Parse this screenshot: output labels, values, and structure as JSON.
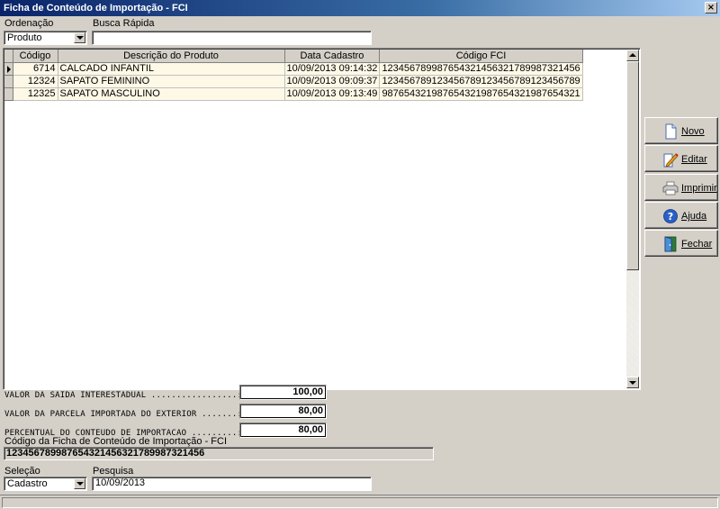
{
  "window": {
    "title": "Ficha de Conteúdo de Importação - FCI",
    "close_glyph": "×"
  },
  "filters": {
    "ordenacao_label": "Ordenação",
    "ordenacao_value": "Produto",
    "busca_label": "Busca Rápida",
    "busca_value": ""
  },
  "grid": {
    "columns": [
      "Código",
      "Descrição do Produto",
      "Data Cadastro",
      "Código FCI"
    ],
    "rows": [
      {
        "codigo": "6714",
        "descricao": "CALCADO INFANTIL",
        "data": "10/09/2013 09:14:32",
        "fci": "12345678998765432145632178998732145​6",
        "selected": true
      },
      {
        "codigo": "12324",
        "descricao": "SAPATO FEMININO",
        "data": "10/09/2013 09:09:37",
        "fci": "123456789123456789123456789123456789",
        "selected": false
      },
      {
        "codigo": "12325",
        "descricao": "SAPATO MASCULINO",
        "data": "10/09/2013 09:13:49",
        "fci": "987654321987654321987654321987654321",
        "selected": false
      }
    ]
  },
  "actions": {
    "novo": "Novo",
    "editar": "Editar",
    "imprimir": "Imprimir",
    "ajuda": "Ajuda",
    "fechar": "Fechar"
  },
  "details": {
    "saida_label": "VALOR DA SAIDA INTERESTADUAL .................:",
    "saida_value": "100,00",
    "parcela_label": "VALOR DA PARCELA IMPORTADA DO EXTERIOR .......:",
    "parcela_value": "80,00",
    "percentual_label": "PERCENTUAL DO CONTEUDO DE IMPORTACAO .........:",
    "percentual_value": "80,00",
    "fci_code_label": "Código da Ficha de Conteúdo de Importação - FCI",
    "fci_code_value": "123456789987654321456321789987321456"
  },
  "search": {
    "selecao_label": "Seleção",
    "selecao_value": "Cadastro",
    "pesquisa_label": "Pesquisa",
    "pesquisa_value": "10/09/2013"
  },
  "colors": {
    "row_bg": "#fdf9e6",
    "face": "#d4d0c8",
    "title_start": "#0a246a",
    "title_end": "#a6caf0"
  }
}
